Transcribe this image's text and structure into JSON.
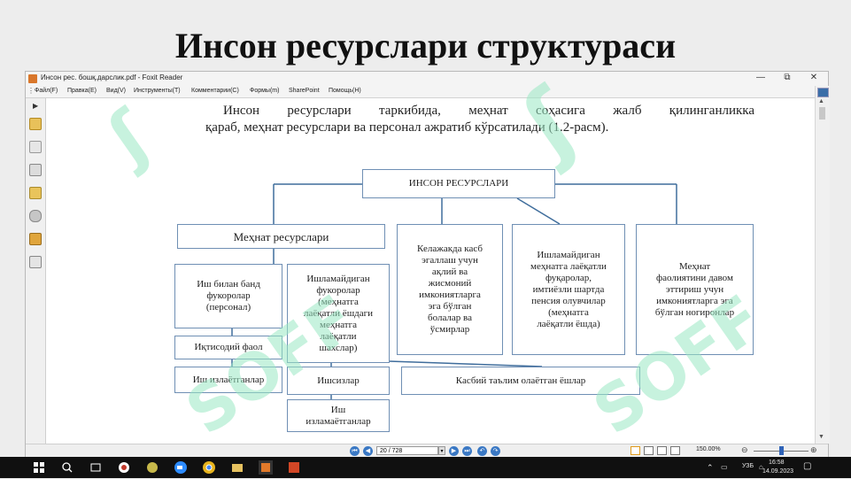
{
  "slide": {
    "title": "Инсон ресурслари структураси"
  },
  "window": {
    "title": "Инсон рес. бошқ.дарслик.pdf - Foxit Reader",
    "controls": [
      "—",
      "⧉",
      "✕"
    ]
  },
  "menu": {
    "items": [
      "Файл(F)",
      "Правка(E)",
      "Вид(V)",
      "Инструменты(T)",
      "Комментарии(C)",
      "Формы(m)",
      "SharePoint",
      "Помощь(H)"
    ]
  },
  "document": {
    "paragraph_line1": "Инсон ресурслари таркибида, меҳнат соҳасига жалб қилинганликка",
    "paragraph_line2": "қараб, меҳнат ресурслари ва персонал ажратиб кўрсатилади (1.2-расм).",
    "diagram": {
      "root": "ИНСОН РЕСУРСЛАРИ",
      "labor_resources": "Меҳнат ресурслари",
      "employed": "Иш билан банд\nфукоролар\n(персонал)",
      "unemployed_able": "Ишламайдиган\nфукоролар\n(меҳнатга\nлаёқатли ёшдаги\nмеҳнатга\nлаёқатли\nшахслар)",
      "future_jobs": "Келажакда касб\nэгаллаш учун\nақлий ва\nжисмоний\nимкониятларга\nэга бўлган\nболалар ва\nўсмирлар",
      "nonworking_pensioners": "Ишламайдиган\nмеҳнатга лаёқатли\nфуқаролар,\nимтиёзли шартда\nпенсия олувчилар\n(меҳнатга\nлаёқатли ёшда)",
      "disabled": "Меҳнат\nфаолиятини давом\nэттириш учун\nимкониятларга эга\nбўлган ногиронлар",
      "economically_active": "Иқтисодий фаол",
      "job_seekers": "Иш излаётганлар",
      "unemployed": "Ишсизлар",
      "vocational_students": "Касбий таълим олаётган ёшлар",
      "not_seeking": "Иш\nизламаётганлар"
    }
  },
  "statusbar": {
    "page_indicator": "20 / 728",
    "zoom": "150.00%"
  },
  "watermark": {
    "text": "SOFF"
  },
  "taskbar": {
    "lang": "УЗБ",
    "time": "16:58",
    "date": "14.09.2023"
  },
  "colors": {
    "box_border": "#6f8fb4",
    "connector": "#3f6d9c",
    "watermark": "#9be8c4",
    "nav_blue": "#3a78c4"
  }
}
